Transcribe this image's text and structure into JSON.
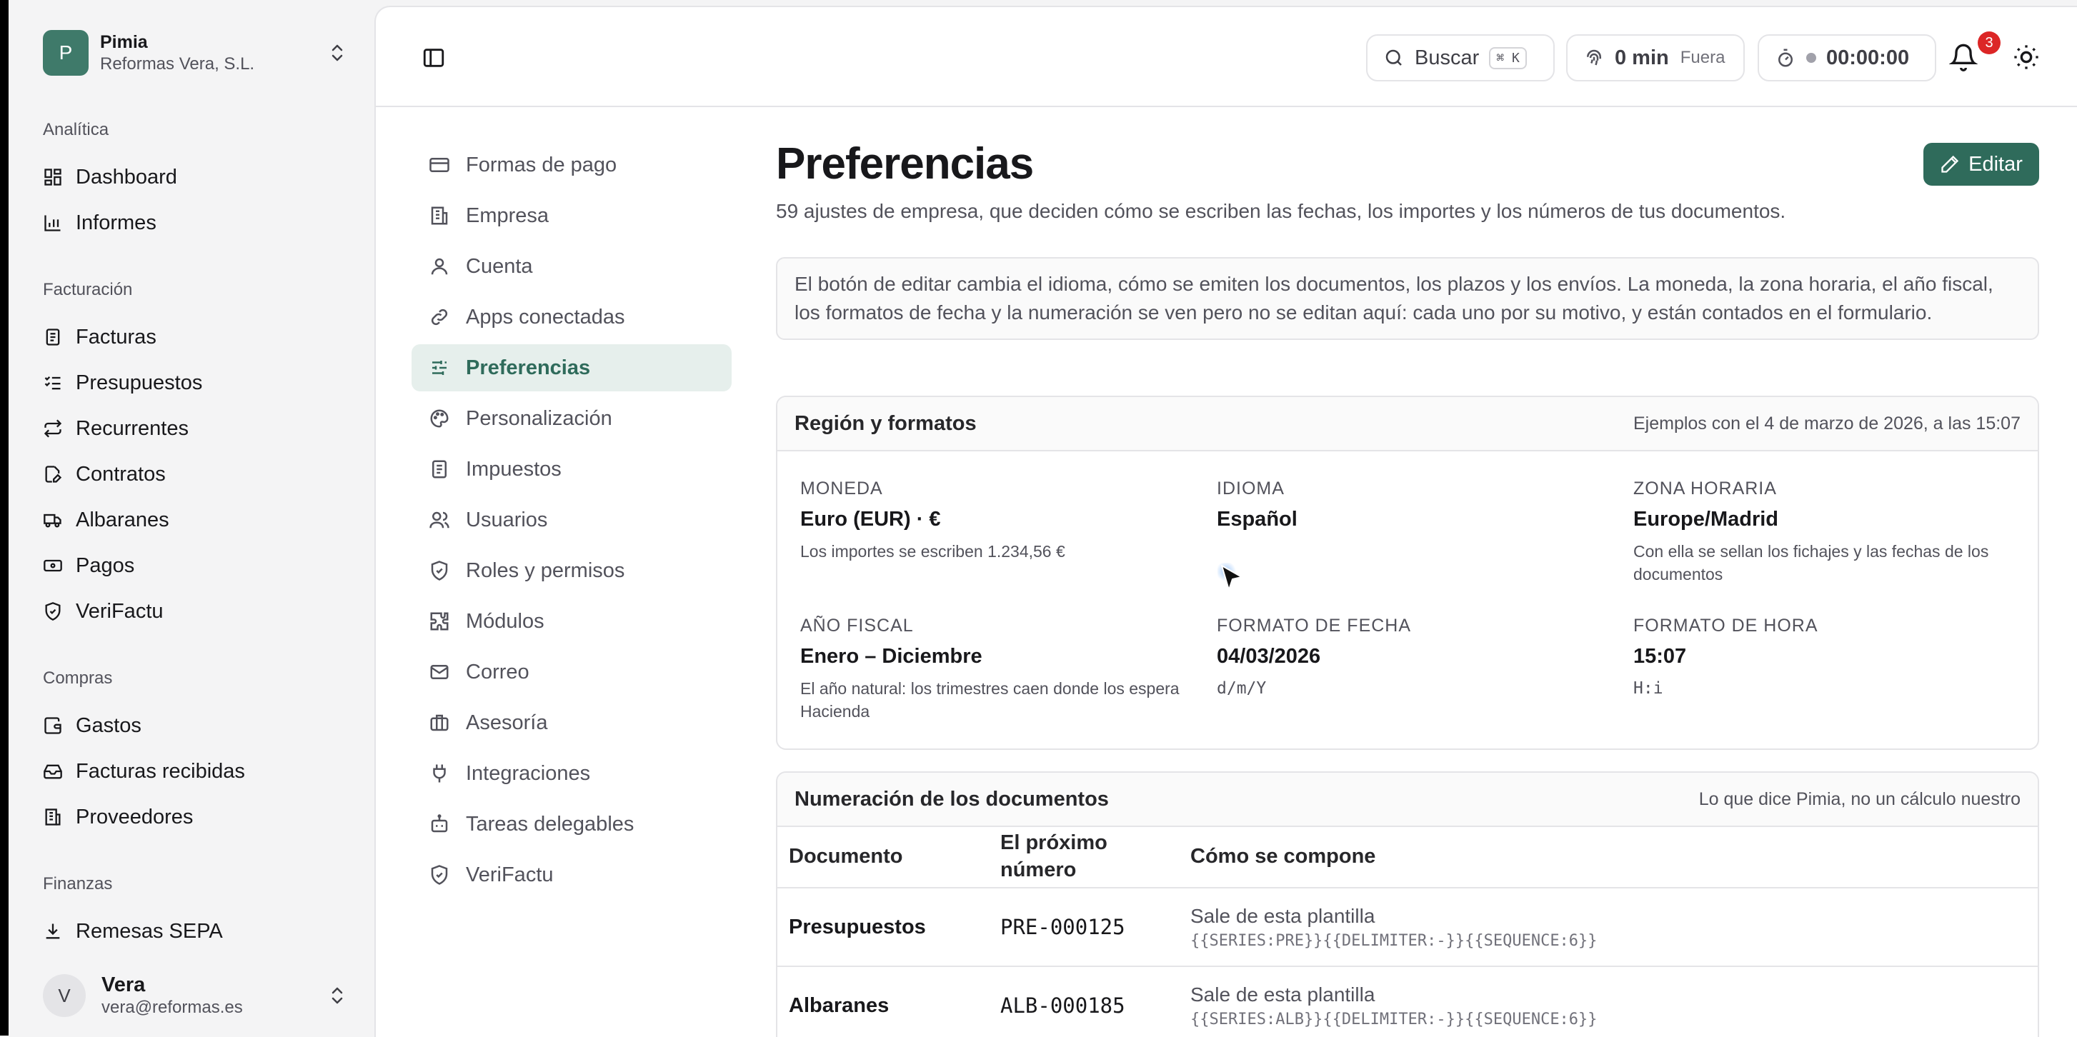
{
  "org": {
    "initial": "P",
    "name": "Pimia",
    "company": "Reformas Vera, S.L."
  },
  "sidebar": {
    "groups": {
      "analitica": "Analítica",
      "facturacion": "Facturación",
      "compras": "Compras",
      "finanzas": "Finanzas"
    },
    "items": {
      "dashboard": "Dashboard",
      "informes": "Informes",
      "facturas": "Facturas",
      "presupuestos": "Presupuestos",
      "recurrentes": "Recurrentes",
      "contratos": "Contratos",
      "albaranes": "Albaranes",
      "pagos": "Pagos",
      "verifactu": "VeriFactu",
      "gastos": "Gastos",
      "facturas_recibidas": "Facturas recibidas",
      "proveedores": "Proveedores",
      "remesas": "Remesas SEPA"
    }
  },
  "user": {
    "initial": "V",
    "name": "Vera",
    "email": "vera@reformas.es"
  },
  "topbar": {
    "search_label": "Buscar",
    "search_shortcut": "⌘ K",
    "clock_value": "0 min",
    "clock_status": "Fuera",
    "timer_value": "00:00:00",
    "notifications_count": "3"
  },
  "settings_nav": {
    "formas_pago": "Formas de pago",
    "empresa": "Empresa",
    "cuenta": "Cuenta",
    "apps": "Apps conectadas",
    "preferencias": "Preferencias",
    "personalizacion": "Personalización",
    "impuestos": "Impuestos",
    "usuarios": "Usuarios",
    "roles": "Roles y permisos",
    "modulos": "Módulos",
    "correo": "Correo",
    "asesoria": "Asesoría",
    "integraciones": "Integraciones",
    "tareas": "Tareas delegables",
    "verifactu": "VeriFactu"
  },
  "page": {
    "title": "Preferencias",
    "subtitle": "59 ajustes de empresa, que deciden cómo se escriben las fechas, los importes y los números de tus documentos.",
    "edit_label": "Editar",
    "note": "El botón de editar cambia el idioma, cómo se emiten los documentos, los plazos y los envíos. La moneda, la zona horaria, el año fiscal, los formatos de fecha y la numeración se ven pero no se editan aquí: cada uno por su motivo, y están contados en el formulario."
  },
  "region": {
    "title": "Región y formatos",
    "example": "Ejemplos con el 4 de marzo de 2026, a las 15:07",
    "moneda": {
      "label": "MONEDA",
      "value": "Euro (EUR) · €",
      "desc": "Los importes se escriben 1.234,56 €"
    },
    "idioma": {
      "label": "IDIOMA",
      "value": "Español"
    },
    "zona": {
      "label": "ZONA HORARIA",
      "value": "Europe/Madrid",
      "desc": "Con ella se sellan los fichajes y las fechas de los documentos"
    },
    "anio": {
      "label": "AÑO FISCAL",
      "value": "Enero – Diciembre",
      "desc": "El año natural: los trimestres caen donde los espera Hacienda"
    },
    "fecha": {
      "label": "FORMATO DE FECHA",
      "value": "04/03/2026",
      "desc": "d/m/Y"
    },
    "hora": {
      "label": "FORMATO DE HORA",
      "value": "15:07",
      "desc": "H:i"
    }
  },
  "numeracion": {
    "title": "Numeración de los documentos",
    "note": "Lo que dice Pimia, no un cálculo nuestro",
    "headers": {
      "doc": "Documento",
      "next": "El próximo número",
      "compose": "Cómo se compone"
    },
    "rows": [
      {
        "doc": "Presupuestos",
        "next": "PRE-000125",
        "compose": "Sale de esta plantilla",
        "template": "{{SERIES:PRE}}{{DELIMITER:-}}{{SEQUENCE:6}}"
      },
      {
        "doc": "Albaranes",
        "next": "ALB-000185",
        "compose": "Sale de esta plantilla",
        "template": "{{SERIES:ALB}}{{DELIMITER:-}}{{SEQUENCE:6}}"
      }
    ]
  }
}
